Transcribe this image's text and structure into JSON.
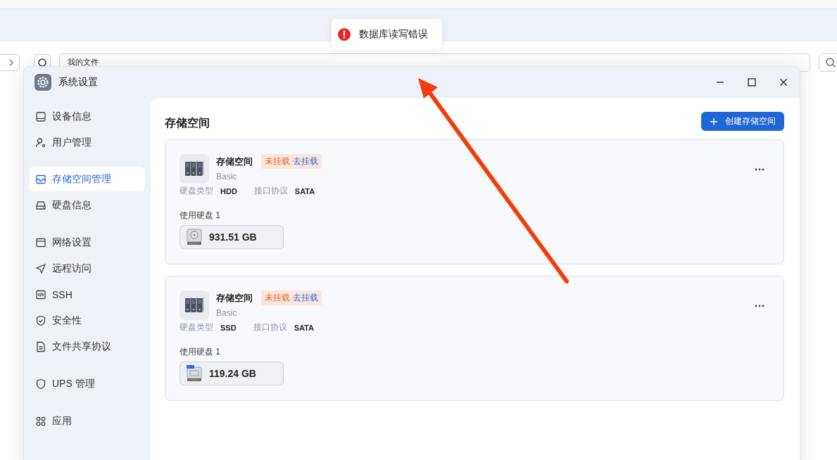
{
  "browser": {
    "path_field": {
      "value": "我的文件"
    }
  },
  "toast": {
    "kind": "error",
    "message": "数据库读写错误"
  },
  "window": {
    "title": "系统设置"
  },
  "sidebar": {
    "groups": [
      {
        "items": [
          {
            "label": "设备信息",
            "kind": "device",
            "selected": false
          },
          {
            "label": "用户管理",
            "kind": "user",
            "selected": false
          }
        ]
      },
      {
        "items": [
          {
            "label": "存储空间管理",
            "kind": "storage",
            "selected": true
          },
          {
            "label": "硬盘信息",
            "kind": "disk",
            "selected": false
          }
        ]
      },
      {
        "items": [
          {
            "label": "网络设置",
            "kind": "network",
            "selected": false
          },
          {
            "label": "远程访问",
            "kind": "remote",
            "selected": false
          },
          {
            "label": "SSH",
            "kind": "code",
            "selected": false
          },
          {
            "label": "安全性",
            "kind": "security",
            "selected": false
          },
          {
            "label": "文件共享协议",
            "kind": "file",
            "selected": false
          }
        ]
      },
      {
        "items": [
          {
            "label": "UPS 管理",
            "kind": "shield",
            "selected": false
          }
        ]
      },
      {
        "items": [
          {
            "label": "应用",
            "kind": "apps",
            "selected": false
          }
        ]
      }
    ]
  },
  "content": {
    "title": "存储空间",
    "create_button": "创建存储空间",
    "pools": [
      {
        "name": "存储空间",
        "status": "未挂载",
        "action": "去挂载",
        "raid": "Basic",
        "disk_type_label": "硬盘类型",
        "disk_type": "HDD",
        "interface_label": "接口协议",
        "interface": "SATA",
        "disks_label": "使用硬盘 1",
        "disks": [
          {
            "kind": "hdd",
            "size": "931.51 GB"
          }
        ]
      },
      {
        "name": "存储空间",
        "status": "未挂载",
        "action": "去挂载",
        "raid": "Basic",
        "disk_type_label": "硬盘类型",
        "disk_type": "SSD",
        "interface_label": "接口协议",
        "interface": "SATA",
        "disks_label": "使用硬盘 1",
        "disks": [
          {
            "kind": "ssd",
            "size": "119.24 GB"
          }
        ]
      }
    ]
  }
}
